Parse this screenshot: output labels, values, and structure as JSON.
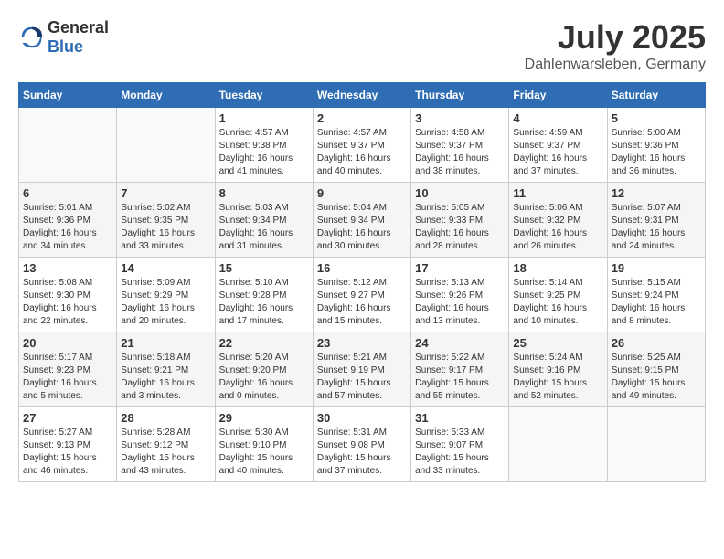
{
  "header": {
    "logo": {
      "text_general": "General",
      "text_blue": "Blue"
    },
    "month": "July 2025",
    "location": "Dahlenwarsleben, Germany"
  },
  "weekdays": [
    "Sunday",
    "Monday",
    "Tuesday",
    "Wednesday",
    "Thursday",
    "Friday",
    "Saturday"
  ],
  "weeks": [
    [
      {
        "day": "",
        "sunrise": "",
        "sunset": "",
        "daylight": ""
      },
      {
        "day": "",
        "sunrise": "",
        "sunset": "",
        "daylight": ""
      },
      {
        "day": "1",
        "sunrise": "Sunrise: 4:57 AM",
        "sunset": "Sunset: 9:38 PM",
        "daylight": "Daylight: 16 hours and 41 minutes."
      },
      {
        "day": "2",
        "sunrise": "Sunrise: 4:57 AM",
        "sunset": "Sunset: 9:37 PM",
        "daylight": "Daylight: 16 hours and 40 minutes."
      },
      {
        "day": "3",
        "sunrise": "Sunrise: 4:58 AM",
        "sunset": "Sunset: 9:37 PM",
        "daylight": "Daylight: 16 hours and 38 minutes."
      },
      {
        "day": "4",
        "sunrise": "Sunrise: 4:59 AM",
        "sunset": "Sunset: 9:37 PM",
        "daylight": "Daylight: 16 hours and 37 minutes."
      },
      {
        "day": "5",
        "sunrise": "Sunrise: 5:00 AM",
        "sunset": "Sunset: 9:36 PM",
        "daylight": "Daylight: 16 hours and 36 minutes."
      }
    ],
    [
      {
        "day": "6",
        "sunrise": "Sunrise: 5:01 AM",
        "sunset": "Sunset: 9:36 PM",
        "daylight": "Daylight: 16 hours and 34 minutes."
      },
      {
        "day": "7",
        "sunrise": "Sunrise: 5:02 AM",
        "sunset": "Sunset: 9:35 PM",
        "daylight": "Daylight: 16 hours and 33 minutes."
      },
      {
        "day": "8",
        "sunrise": "Sunrise: 5:03 AM",
        "sunset": "Sunset: 9:34 PM",
        "daylight": "Daylight: 16 hours and 31 minutes."
      },
      {
        "day": "9",
        "sunrise": "Sunrise: 5:04 AM",
        "sunset": "Sunset: 9:34 PM",
        "daylight": "Daylight: 16 hours and 30 minutes."
      },
      {
        "day": "10",
        "sunrise": "Sunrise: 5:05 AM",
        "sunset": "Sunset: 9:33 PM",
        "daylight": "Daylight: 16 hours and 28 minutes."
      },
      {
        "day": "11",
        "sunrise": "Sunrise: 5:06 AM",
        "sunset": "Sunset: 9:32 PM",
        "daylight": "Daylight: 16 hours and 26 minutes."
      },
      {
        "day": "12",
        "sunrise": "Sunrise: 5:07 AM",
        "sunset": "Sunset: 9:31 PM",
        "daylight": "Daylight: 16 hours and 24 minutes."
      }
    ],
    [
      {
        "day": "13",
        "sunrise": "Sunrise: 5:08 AM",
        "sunset": "Sunset: 9:30 PM",
        "daylight": "Daylight: 16 hours and 22 minutes."
      },
      {
        "day": "14",
        "sunrise": "Sunrise: 5:09 AM",
        "sunset": "Sunset: 9:29 PM",
        "daylight": "Daylight: 16 hours and 20 minutes."
      },
      {
        "day": "15",
        "sunrise": "Sunrise: 5:10 AM",
        "sunset": "Sunset: 9:28 PM",
        "daylight": "Daylight: 16 hours and 17 minutes."
      },
      {
        "day": "16",
        "sunrise": "Sunrise: 5:12 AM",
        "sunset": "Sunset: 9:27 PM",
        "daylight": "Daylight: 16 hours and 15 minutes."
      },
      {
        "day": "17",
        "sunrise": "Sunrise: 5:13 AM",
        "sunset": "Sunset: 9:26 PM",
        "daylight": "Daylight: 16 hours and 13 minutes."
      },
      {
        "day": "18",
        "sunrise": "Sunrise: 5:14 AM",
        "sunset": "Sunset: 9:25 PM",
        "daylight": "Daylight: 16 hours and 10 minutes."
      },
      {
        "day": "19",
        "sunrise": "Sunrise: 5:15 AM",
        "sunset": "Sunset: 9:24 PM",
        "daylight": "Daylight: 16 hours and 8 minutes."
      }
    ],
    [
      {
        "day": "20",
        "sunrise": "Sunrise: 5:17 AM",
        "sunset": "Sunset: 9:23 PM",
        "daylight": "Daylight: 16 hours and 5 minutes."
      },
      {
        "day": "21",
        "sunrise": "Sunrise: 5:18 AM",
        "sunset": "Sunset: 9:21 PM",
        "daylight": "Daylight: 16 hours and 3 minutes."
      },
      {
        "day": "22",
        "sunrise": "Sunrise: 5:20 AM",
        "sunset": "Sunset: 9:20 PM",
        "daylight": "Daylight: 16 hours and 0 minutes."
      },
      {
        "day": "23",
        "sunrise": "Sunrise: 5:21 AM",
        "sunset": "Sunset: 9:19 PM",
        "daylight": "Daylight: 15 hours and 57 minutes."
      },
      {
        "day": "24",
        "sunrise": "Sunrise: 5:22 AM",
        "sunset": "Sunset: 9:17 PM",
        "daylight": "Daylight: 15 hours and 55 minutes."
      },
      {
        "day": "25",
        "sunrise": "Sunrise: 5:24 AM",
        "sunset": "Sunset: 9:16 PM",
        "daylight": "Daylight: 15 hours and 52 minutes."
      },
      {
        "day": "26",
        "sunrise": "Sunrise: 5:25 AM",
        "sunset": "Sunset: 9:15 PM",
        "daylight": "Daylight: 15 hours and 49 minutes."
      }
    ],
    [
      {
        "day": "27",
        "sunrise": "Sunrise: 5:27 AM",
        "sunset": "Sunset: 9:13 PM",
        "daylight": "Daylight: 15 hours and 46 minutes."
      },
      {
        "day": "28",
        "sunrise": "Sunrise: 5:28 AM",
        "sunset": "Sunset: 9:12 PM",
        "daylight": "Daylight: 15 hours and 43 minutes."
      },
      {
        "day": "29",
        "sunrise": "Sunrise: 5:30 AM",
        "sunset": "Sunset: 9:10 PM",
        "daylight": "Daylight: 15 hours and 40 minutes."
      },
      {
        "day": "30",
        "sunrise": "Sunrise: 5:31 AM",
        "sunset": "Sunset: 9:08 PM",
        "daylight": "Daylight: 15 hours and 37 minutes."
      },
      {
        "day": "31",
        "sunrise": "Sunrise: 5:33 AM",
        "sunset": "Sunset: 9:07 PM",
        "daylight": "Daylight: 15 hours and 33 minutes."
      },
      {
        "day": "",
        "sunrise": "",
        "sunset": "",
        "daylight": ""
      },
      {
        "day": "",
        "sunrise": "",
        "sunset": "",
        "daylight": ""
      }
    ]
  ]
}
